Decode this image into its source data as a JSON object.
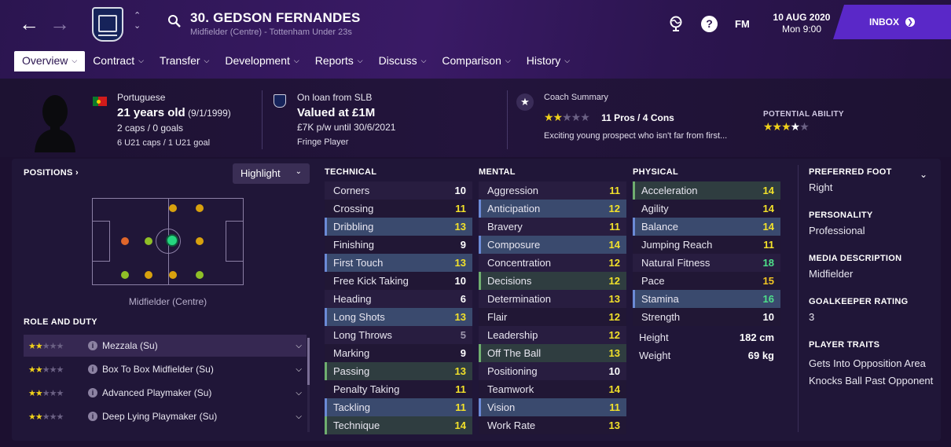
{
  "header": {
    "player_name": "30. GEDSON FERNANDES",
    "player_sub": "Midfielder (Centre) - Tottenham Under 23s",
    "fm_label": "FM",
    "date_line1": "10 AUG 2020",
    "date_line2": "Mon 9:00",
    "inbox_label": "INBOX",
    "icons": [
      "back-arrow-icon",
      "forward-arrow-icon",
      "club-crest-icon",
      "search-icon",
      "globe-icon",
      "help-icon"
    ]
  },
  "tabs": [
    {
      "label": "Overview"
    },
    {
      "label": "Contract"
    },
    {
      "label": "Transfer"
    },
    {
      "label": "Development"
    },
    {
      "label": "Reports"
    },
    {
      "label": "Discuss"
    },
    {
      "label": "Comparison"
    },
    {
      "label": "History"
    }
  ],
  "profile": {
    "nationality": "Portuguese",
    "age": "21 years old",
    "dob": "(9/1/1999)",
    "caps": "2 caps / 0 goals",
    "u21": "6 U21 caps / 1 U21 goal",
    "loan_from": "On loan from SLB",
    "value": "Valued at £1M",
    "wage": "£7K p/w until 30/6/2021",
    "squad_status": "Fringe Player",
    "coach_label": "Coach Summary",
    "coach_stars": 2,
    "pros_cons": "11 Pros / 4 Cons",
    "coach_text": "Exciting young prospect who isn't far from first...",
    "pa_label": "POTENTIAL ABILITY",
    "pa_stars": 3.5
  },
  "positions": {
    "title": "POSITIONS",
    "highlight_label": "Highlight",
    "position_caption": "Midfielder (Centre)",
    "role_title": "ROLE AND DUTY",
    "roles": [
      {
        "name": "Mezzala (Su)",
        "stars": 2
      },
      {
        "name": "Box To Box Midfielder (Su)",
        "stars": 2
      },
      {
        "name": "Advanced Playmaker (Su)",
        "stars": 2
      },
      {
        "name": "Deep Lying Playmaker (Su)",
        "stars": 2
      }
    ]
  },
  "technical": {
    "title": "TECHNICAL",
    "rows": [
      {
        "name": "Corners",
        "value": "10"
      },
      {
        "name": "Crossing",
        "value": "11"
      },
      {
        "name": "Dribbling",
        "value": "13"
      },
      {
        "name": "Finishing",
        "value": "9"
      },
      {
        "name": "First Touch",
        "value": "13"
      },
      {
        "name": "Free Kick Taking",
        "value": "10"
      },
      {
        "name": "Heading",
        "value": "6"
      },
      {
        "name": "Long Shots",
        "value": "13"
      },
      {
        "name": "Long Throws",
        "value": "5"
      },
      {
        "name": "Marking",
        "value": "9"
      },
      {
        "name": "Passing",
        "value": "13"
      },
      {
        "name": "Penalty Taking",
        "value": "11"
      },
      {
        "name": "Tackling",
        "value": "11"
      },
      {
        "name": "Technique",
        "value": "14"
      }
    ]
  },
  "mental": {
    "title": "MENTAL",
    "rows": [
      {
        "name": "Aggression",
        "value": "11"
      },
      {
        "name": "Anticipation",
        "value": "12"
      },
      {
        "name": "Bravery",
        "value": "11"
      },
      {
        "name": "Composure",
        "value": "14"
      },
      {
        "name": "Concentration",
        "value": "12"
      },
      {
        "name": "Decisions",
        "value": "12"
      },
      {
        "name": "Determination",
        "value": "13"
      },
      {
        "name": "Flair",
        "value": "12"
      },
      {
        "name": "Leadership",
        "value": "12"
      },
      {
        "name": "Off The Ball",
        "value": "13"
      },
      {
        "name": "Positioning",
        "value": "10"
      },
      {
        "name": "Teamwork",
        "value": "14"
      },
      {
        "name": "Vision",
        "value": "11"
      },
      {
        "name": "Work Rate",
        "value": "13"
      }
    ]
  },
  "physical": {
    "title": "PHYSICAL",
    "rows": [
      {
        "name": "Acceleration",
        "value": "14"
      },
      {
        "name": "Agility",
        "value": "14"
      },
      {
        "name": "Balance",
        "value": "14"
      },
      {
        "name": "Jumping Reach",
        "value": "11"
      },
      {
        "name": "Natural Fitness",
        "value": "18"
      },
      {
        "name": "Pace",
        "value": "15"
      },
      {
        "name": "Stamina",
        "value": "16"
      },
      {
        "name": "Strength",
        "value": "10"
      }
    ],
    "height_label": "Height",
    "height": "182 cm",
    "weight_label": "Weight",
    "weight": "69 kg"
  },
  "side": {
    "foot_label": "PREFERRED FOOT",
    "foot": "Right",
    "personality_label": "PERSONALITY",
    "personality": "Professional",
    "media_label": "MEDIA DESCRIPTION",
    "media": "Midfielder",
    "gk_label": "GOALKEEPER RATING",
    "gk": "3",
    "traits_label": "PLAYER TRAITS",
    "trait1": "Gets Into Opposition Area",
    "trait2": "Knocks Ball Past Opponent"
  },
  "colors": {
    "accent": "#5a28c8",
    "value_yellow": "#f2e12a",
    "value_green": "#4ee08a",
    "position_main": "#25d680"
  }
}
